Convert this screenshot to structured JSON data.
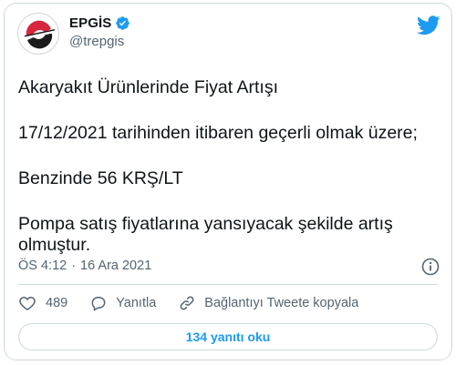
{
  "account": {
    "display_name": "EPGİS",
    "handle": "@trepgis",
    "verified": true,
    "avatar_icon": "epgis-logo"
  },
  "tweet": {
    "lines": [
      "Akaryakıt Ürünlerinde Fiyat Artışı",
      "17/12/2021 tarihinden itibaren geçerli olmak üzere;",
      "Benzinde 56 KRŞ/LT",
      "Pompa satış fiyatlarına yansıyacak şekilde artış",
      "olmuştur."
    ],
    "time": "ÖS 4:12",
    "separator": "·",
    "date": "16 Ara 2021"
  },
  "actions": {
    "like_count": "489",
    "reply_label": "Yanıtla",
    "copy_link_label": "Bağlantıyı Tweete kopyala"
  },
  "footer": {
    "replies_button_label": "134 yanıtı oku"
  },
  "colors": {
    "accent": "#1d9bf0",
    "secondary_text": "#536471",
    "border": "#cfd9de",
    "logo_red": "#d7263d"
  }
}
